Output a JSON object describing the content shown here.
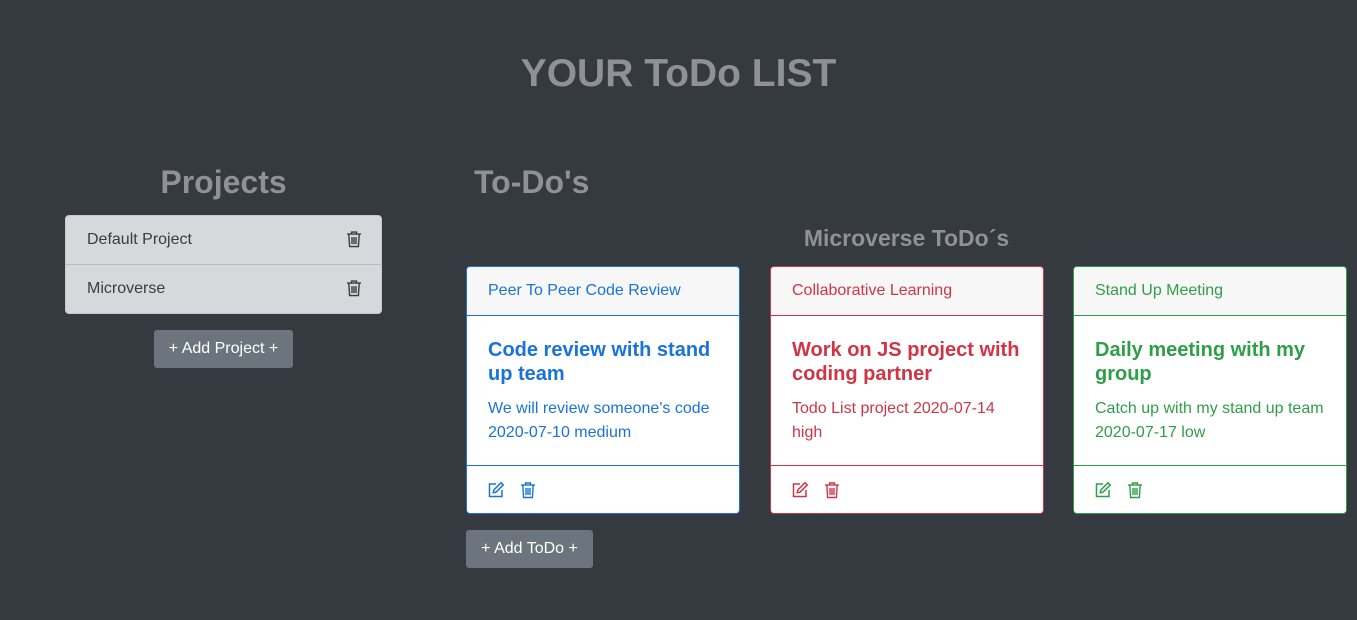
{
  "page_title": "YOUR ToDo LIST",
  "projects": {
    "heading": "Projects",
    "items": [
      {
        "label": "Default Project",
        "icon": "trash-icon"
      },
      {
        "label": "Microverse",
        "icon": "trash-icon"
      }
    ],
    "add_button": "+ Add Project +"
  },
  "todos": {
    "heading": "To-Do's",
    "project_heading": "Microverse ToDo´s",
    "add_button": "+ Add ToDo +",
    "cards": [
      {
        "header": "Peer To Peer Code Review",
        "title": "Code review with stand up team",
        "text": "We will review someone's code 2020-07-10 medium",
        "color": "#1a73d9"
      },
      {
        "header": "Collaborative Learning",
        "title": "Work on JS project with coding partner",
        "text": "Todo List project 2020-07-14 high",
        "color": "#cf3545"
      },
      {
        "header": "Stand Up Meeting",
        "title": "Daily meeting with my group",
        "text": "Catch up with my stand up team 2020-07-17 low",
        "color": "#2f9e48"
      }
    ]
  },
  "colors": {
    "background": "#343a40",
    "heading": "#8e9196",
    "button": "#6c757d",
    "project_list": "#d6d8db"
  }
}
